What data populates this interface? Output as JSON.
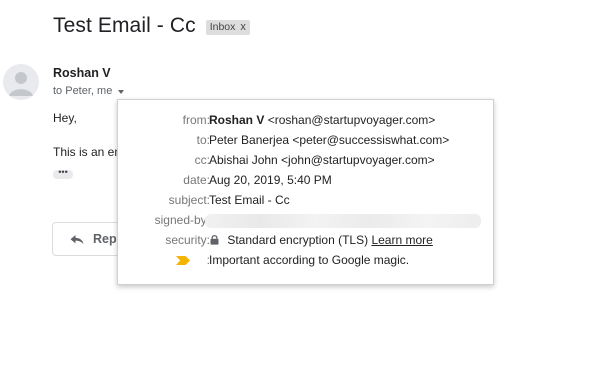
{
  "header": {
    "subject": "Test Email - Cc",
    "label_chip": "Inbox",
    "label_close": "x"
  },
  "message": {
    "sender_name": "Roshan V",
    "recipients_summary": "to Peter, me",
    "greeting": "Hey,",
    "body_partial": "This is an em",
    "ellipsis": "•••",
    "reply_label": "Rep"
  },
  "details": {
    "from_label": "from:",
    "from_name": "Roshan V",
    "from_email": "<roshan@startupvoyager.com>",
    "to_label": "to:",
    "to_value": "Peter Banerjea <peter@successiswhat.com>",
    "cc_label": "cc:",
    "cc_value": "Abishai John <john@startupvoyager.com>",
    "date_label": "date:",
    "date_value": "Aug 20, 2019, 5:40 PM",
    "subject_label": "subject:",
    "subject_value": "Test Email - Cc",
    "signed_by_label": "signed-by:",
    "security_label": "security:",
    "security_value": "Standard encryption (TLS)",
    "learn_more": "Learn more",
    "importance_colon": ":",
    "importance_value": "Important according to Google magic."
  },
  "colors": {
    "important_marker": "#f4b400",
    "chip_background": "#dddddd",
    "avatar_background": "#e8eaed"
  }
}
